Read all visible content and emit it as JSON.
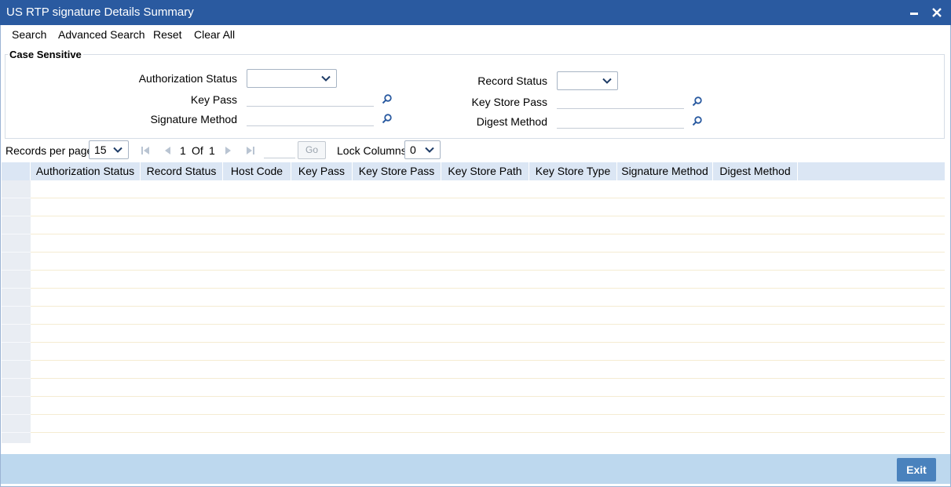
{
  "window": {
    "title": "US RTP signature Details Summary"
  },
  "menu": {
    "search": "Search",
    "advanced_search": "Advanced Search",
    "reset": "Reset",
    "clear_all": "Clear All"
  },
  "criteria": {
    "legend": "Case Sensitive",
    "authorization_status": {
      "label": "Authorization Status",
      "value": ""
    },
    "record_status": {
      "label": "Record Status",
      "value": ""
    },
    "key_pass": {
      "label": "Key Pass",
      "value": ""
    },
    "key_store_pass": {
      "label": "Key Store Pass",
      "value": ""
    },
    "signature_method": {
      "label": "Signature Method",
      "value": ""
    },
    "digest_method": {
      "label": "Digest Method",
      "value": ""
    }
  },
  "pager": {
    "records_per_page_label": "Records per page",
    "records_per_page": "15",
    "current_page": "1",
    "of_label": "Of",
    "total_pages": "1",
    "go_label": "Go",
    "lock_columns_label": "Lock Columns",
    "lock_columns": "0"
  },
  "grid": {
    "columns": [
      "Authorization Status",
      "Record Status",
      "Host Code",
      "Key Pass",
      "Key Store Pass",
      "Key Store Path",
      "Key Store Type",
      "Signature Method",
      "Digest Method"
    ],
    "rows": []
  },
  "footer": {
    "exit_label": "Exit"
  },
  "colors": {
    "titlebar": "#2a5aa0",
    "grid_header": "#dbe6f4",
    "footer": "#bdd8ee",
    "exit_button": "#4a82bd"
  },
  "icons": {
    "minimize": "minimize-icon",
    "close": "close-icon",
    "lookup": "search-icon",
    "dropdown": "chevron-down-icon"
  }
}
